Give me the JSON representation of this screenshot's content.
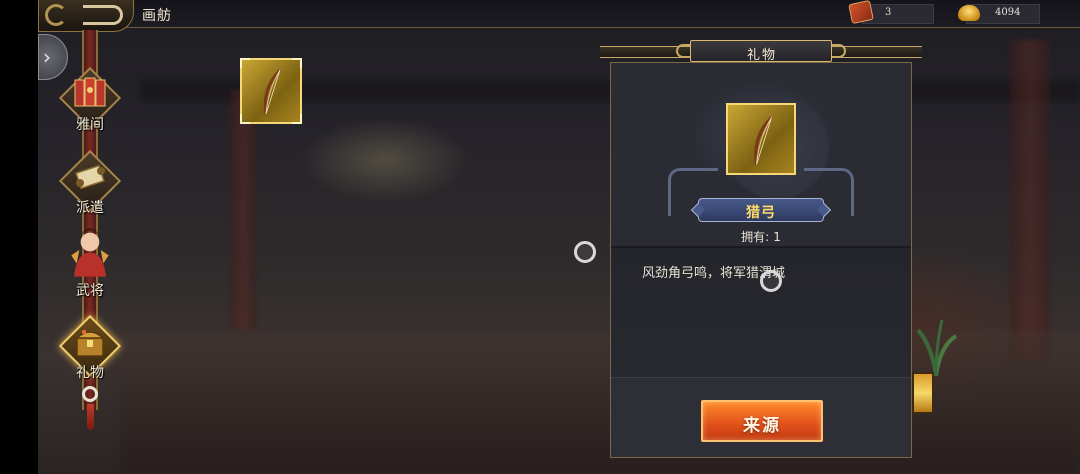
{
  "header": {
    "title": "画舫",
    "token_count": "3",
    "ingot_count": "4094"
  },
  "nav": {
    "items": [
      {
        "label": "雅间",
        "icon": "folding-screen-icon",
        "active": false
      },
      {
        "label": "派遣",
        "icon": "scroll-icon",
        "active": false
      },
      {
        "label": "武将",
        "icon": "general-portrait-icon",
        "active": false
      },
      {
        "label": "礼物",
        "icon": "treasure-chest-icon",
        "active": true
      }
    ]
  },
  "inventory": {
    "items": [
      {
        "icon": "hunting-bow-icon",
        "selected": true
      }
    ]
  },
  "detail": {
    "panel_title": "礼物",
    "item_name": "猎弓",
    "owned_label": "拥有:",
    "owned_count": "1",
    "description": "风劲角弓鸣，将军猎渭城",
    "source_button": "来源"
  },
  "colors": {
    "gold_frame": "#f6d878",
    "name_color": "#ffdd66",
    "button_orange": "#e0501a"
  }
}
